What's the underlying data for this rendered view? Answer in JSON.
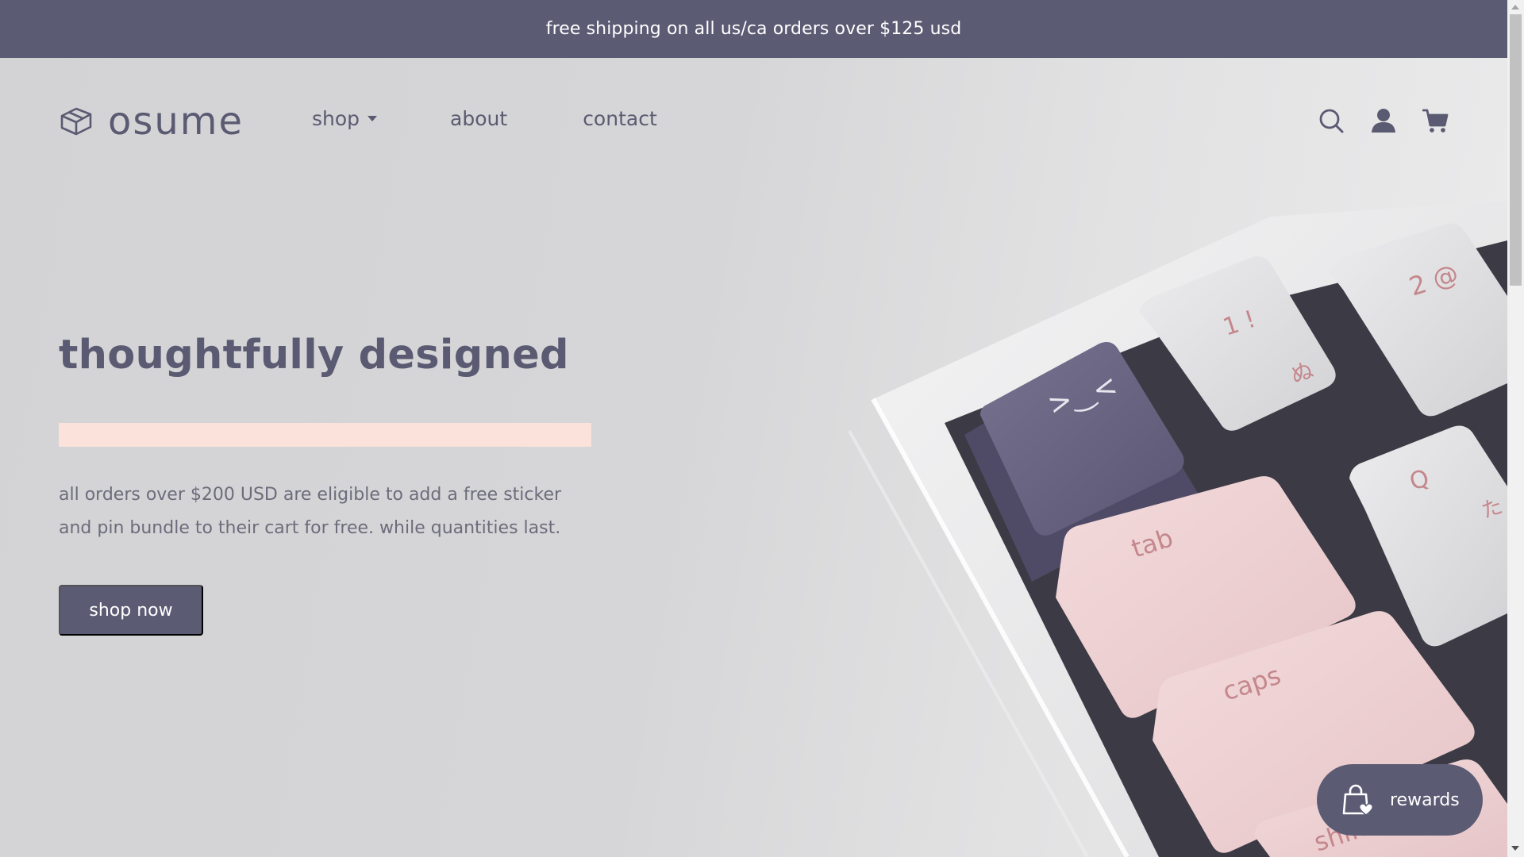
{
  "announcement": {
    "text": "free shipping on all us/ca orders over $125 usd"
  },
  "header": {
    "logo_text": "osume",
    "nav": [
      {
        "label": "shop",
        "has_dropdown": true
      },
      {
        "label": "about"
      },
      {
        "label": "contact"
      }
    ],
    "icons": [
      "search-icon",
      "account-icon",
      "cart-icon"
    ]
  },
  "hero": {
    "title": "thoughtfully designed",
    "body": "all orders over $200 USD are eligible to add a free sticker and pin bundle to their cart for free. while quantities last.",
    "cta_label": "shop now"
  },
  "keycaps": {
    "smile": ">‿<",
    "one": "1 !",
    "one_kana": "ぬ",
    "two": "2 @",
    "q": "Q",
    "q_kana": "た",
    "tab": "tab",
    "caps": "caps",
    "shift": "shift"
  },
  "rewards": {
    "label": "rewards"
  },
  "colors": {
    "brand_dark": "#5b5b74",
    "accent_pink": "#fbe3dc",
    "text": "#5a5a72"
  }
}
